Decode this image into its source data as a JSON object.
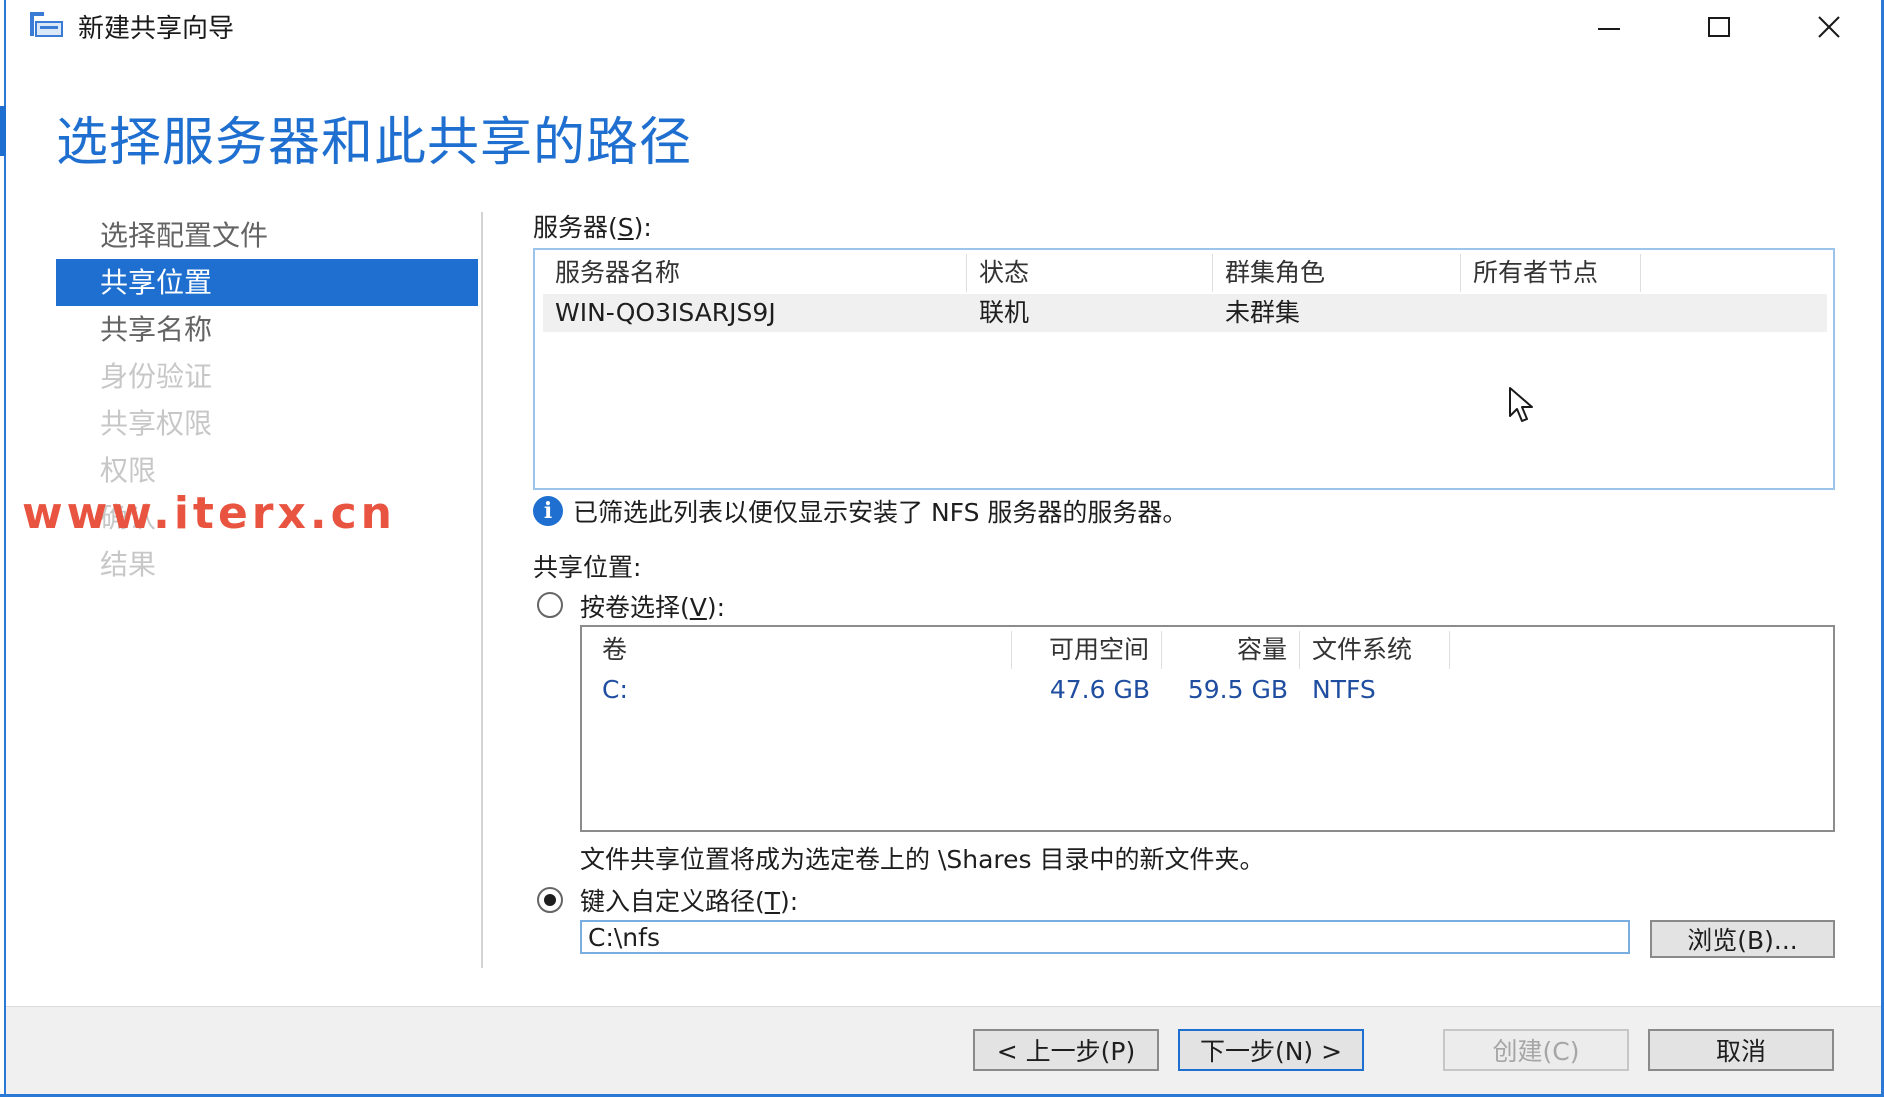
{
  "window": {
    "title": "新建共享向导",
    "accent_color": "#1e6fd0"
  },
  "page_title": "选择服务器和此共享的路径",
  "nav": {
    "items": [
      {
        "label": "选择配置文件",
        "state": "normal"
      },
      {
        "label": "共享位置",
        "state": "active"
      },
      {
        "label": "共享名称",
        "state": "normal"
      },
      {
        "label": "身份验证",
        "state": "disabled"
      },
      {
        "label": "共享权限",
        "state": "disabled"
      },
      {
        "label": "权限",
        "state": "disabled"
      },
      {
        "label": "确认",
        "state": "disabled"
      },
      {
        "label": "结果",
        "state": "disabled"
      }
    ]
  },
  "watermark": "www.iterx.cn",
  "server_section": {
    "label_prefix": "服务器(",
    "label_key": "S",
    "label_suffix": "):",
    "columns": [
      "服务器名称",
      "状态",
      "群集角色",
      "所有者节点"
    ],
    "rows": [
      {
        "name": "WIN-QO3ISARJS9J",
        "status": "联机",
        "cluster_role": "未群集",
        "owner_node": ""
      }
    ]
  },
  "info_message": "已筛选此列表以便仅显示安装了 NFS 服务器的服务器。",
  "share_location": {
    "label": "共享位置:",
    "by_volume": {
      "label_prefix": "按卷选择(",
      "label_key": "V",
      "label_suffix": "):",
      "selected": false
    },
    "volume_columns": [
      "卷",
      "可用空间",
      "容量",
      "文件系统"
    ],
    "volumes": [
      {
        "volume": "C:",
        "free": "47.6 GB",
        "capacity": "59.5 GB",
        "fs": "NTFS"
      }
    ],
    "volume_note": "文件共享位置将成为选定卷上的 \\Shares 目录中的新文件夹。",
    "custom_path": {
      "label_prefix": "键入自定义路径(",
      "label_key": "T",
      "label_suffix": "):",
      "selected": true,
      "value": "C:\\nfs"
    },
    "browse_button": "浏览(B)..."
  },
  "footer": {
    "prev_button": "< 上一步(P)",
    "next_button": "下一步(N) >",
    "create_button": "创建(C)",
    "cancel_button": "取消"
  }
}
